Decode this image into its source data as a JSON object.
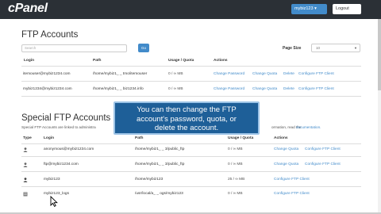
{
  "topbar": {
    "logo": "cPanel",
    "user_label": "mybiz123 ▾",
    "logout_label": "Logout"
  },
  "ftp_accounts": {
    "title": "FTP Accounts",
    "search_placeholder": "Search",
    "go_label": "Go",
    "page_size_label": "Page Size",
    "page_size_value": "10",
    "columns": [
      "Login",
      "Path",
      "Usage / Quota",
      "Actions"
    ],
    "rows": [
      {
        "login": "itemouser@mybiz1234.com",
        "path": "/home/mybiz1_ _ tmo/itemouser",
        "usage": "0 / ∞ MB",
        "actions": [
          "Change Password",
          "Change Quota",
          "Delete",
          "Configure FTP Client"
        ]
      },
      {
        "login": "mybiz1234@mybiz1234.com",
        "path": "/home/mybiz1_ _ biz1234.info",
        "usage": "0 / ∞ MB",
        "actions": [
          "Change Password",
          "Change Quota",
          "Delete",
          "Configure FTP Client"
        ]
      }
    ]
  },
  "special_accounts": {
    "title": "Special FTP Accounts",
    "description": "Special FTP Accounts are linked to administra",
    "description_mid": "ormation, read the",
    "description_link": "documentation.",
    "columns": [
      "Type",
      "Login",
      "Path",
      "Usage / Quota",
      "Actions"
    ],
    "rows": [
      {
        "icon": "user-icon",
        "login": "anonymous@mybiz1234.com",
        "path": "/home/mybiz1_ _ 3/public_ftp",
        "usage": "0 / ∞ MB",
        "actions": [
          "Change Quota",
          "Configure FTP Client"
        ]
      },
      {
        "icon": "user-icon",
        "login": "ftp@mybiz1234.com",
        "path": "/home/mybiz1_ _ 3/public_ftp",
        "usage": "0 / ∞ MB",
        "actions": [
          "Change Quota",
          "Configure FTP Client"
        ]
      },
      {
        "icon": "user-icon",
        "login": "mybiz123",
        "path": "/home/mybiz123",
        "usage": "25 / ∞ MB",
        "actions": [
          "Configure FTP Client"
        ]
      },
      {
        "icon": "server-icon",
        "login": "mybiz123_logs",
        "path": "/usr/local/a_ _ ogs/mybiz123",
        "usage": "0 / ∞ MB",
        "actions": [
          "Configure FTP Client"
        ]
      }
    ]
  },
  "tooltip": {
    "line1": "You can then change the FTP",
    "line2": "account's password, quota, or",
    "line3": "delete the account."
  },
  "colors": {
    "topbar": "#2b3036",
    "accent": "#428bca",
    "tooltip": "#1e5f98"
  }
}
